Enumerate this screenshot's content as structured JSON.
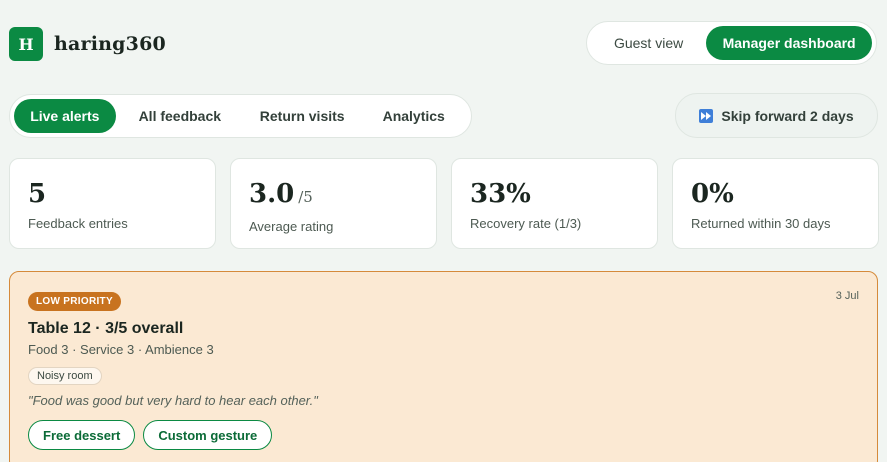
{
  "brand": {
    "logo_letter": "H",
    "name": "haring360"
  },
  "view_toggle": {
    "guest": "Guest view",
    "manager": "Manager dashboard"
  },
  "tabs": [
    {
      "label": "Live alerts",
      "active": true
    },
    {
      "label": "All feedback"
    },
    {
      "label": "Return visits"
    },
    {
      "label": "Analytics"
    }
  ],
  "skip": {
    "icon": "fast-forward-icon",
    "label": "Skip forward 2 days"
  },
  "stats": [
    {
      "value": "5",
      "suffix": "",
      "label": "Feedback entries"
    },
    {
      "value": "3.0",
      "suffix": "/5",
      "label": "Average rating"
    },
    {
      "value": "33%",
      "suffix": "",
      "label": "Recovery rate (1/3)"
    },
    {
      "value": "0%",
      "suffix": "",
      "label": "Returned within 30 days"
    }
  ],
  "alert": {
    "priority": "LOW PRIORITY",
    "date": "3 Jul",
    "title": "Table 12 · 3/5 overall",
    "subtitle": "Food 3 · Service 3 · Ambience 3",
    "tag": "Noisy room",
    "quote": "\"Food was good but very hard to hear each other.\"",
    "actions": [
      "Free dessert",
      "Custom gesture"
    ]
  },
  "colors": {
    "accent": "#0b8a43",
    "alert_bg": "#fbe9d3",
    "priority": "#c8731f"
  }
}
